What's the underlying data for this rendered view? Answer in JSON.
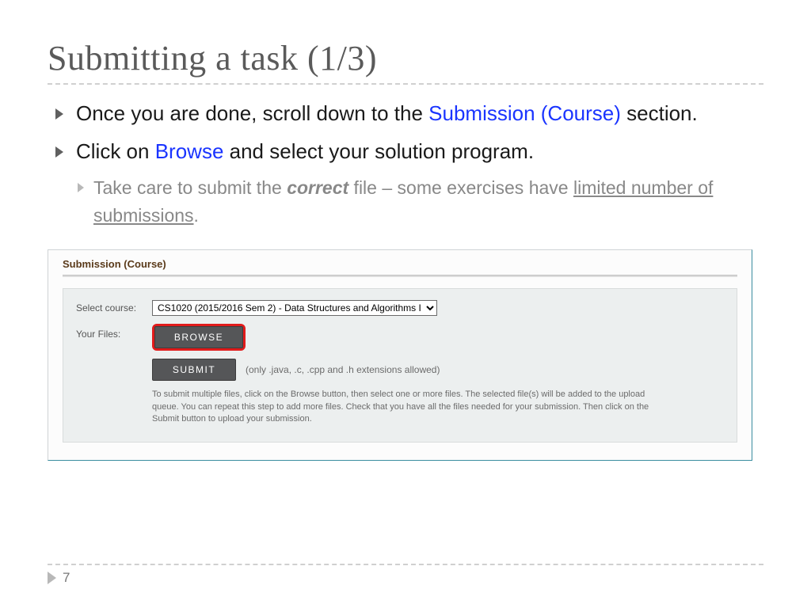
{
  "title": "Submitting a task (1/3)",
  "bullets": {
    "b1_pre": "Once you are done, scroll down to the ",
    "b1_link": "Submission (Course)",
    "b1_post": " section.",
    "b2_pre": "Click on ",
    "b2_link": "Browse",
    "b2_post": " and select your solution program.",
    "sub_pre": "Take care to submit the ",
    "sub_emph": "correct",
    "sub_mid": " file – some exercises have ",
    "sub_under": "limited number of submissions",
    "sub_post": "."
  },
  "panel": {
    "heading": "Submission (Course)",
    "select_label": "Select course:",
    "files_label": "Your Files:",
    "course_option": "CS1020 (2015/2016 Sem 2) - Data Structures and Algorithms I",
    "browse_label": "BROWSE",
    "submit_label": "SUBMIT",
    "allowed_note": "(only .java, .c, .cpp and .h extensions allowed)",
    "help_text": "To submit multiple files, click on the Browse button, then select one or more files. The selected file(s) will be added to the upload queue. You can repeat this step to add more files. Check that you have all the files needed for your submission. Then click on the Submit button to upload your submission."
  },
  "page_number": "7"
}
